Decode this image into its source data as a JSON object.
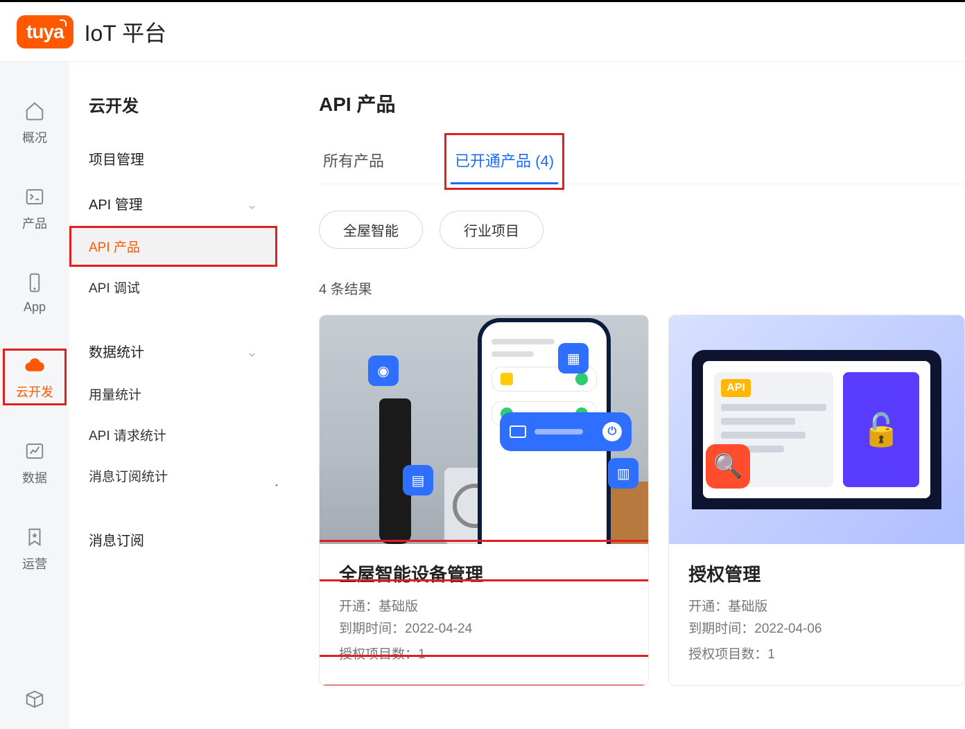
{
  "header": {
    "logo_text": "tuya",
    "platform": "IoT 平台"
  },
  "icon_rail": [
    {
      "id": "overview",
      "label": "概况"
    },
    {
      "id": "product",
      "label": "产品"
    },
    {
      "id": "app",
      "label": "App"
    },
    {
      "id": "cloud-dev",
      "label": "云开发",
      "active": true
    },
    {
      "id": "data",
      "label": "数据"
    },
    {
      "id": "operations",
      "label": "运营"
    }
  ],
  "sidebar": {
    "title": "云开发",
    "items": [
      {
        "type": "single",
        "label": "项目管理"
      },
      {
        "type": "group",
        "label": "API 管理",
        "expanded": true,
        "children": [
          {
            "label": "API 产品",
            "active": true,
            "highlight": true
          },
          {
            "label": "API 调试"
          }
        ]
      },
      {
        "type": "group",
        "label": "数据统计",
        "expanded": true,
        "children": [
          {
            "label": "用量统计"
          },
          {
            "label": "API 请求统计"
          },
          {
            "label": "消息订阅统计"
          }
        ]
      },
      {
        "type": "single",
        "label": "消息订阅"
      }
    ]
  },
  "main": {
    "page_title": "API 产品",
    "tabs": [
      {
        "label": "所有产品"
      },
      {
        "label": "已开通产品 (4)",
        "active": true,
        "highlight": true
      }
    ],
    "filters": [
      {
        "label": "全屋智能"
      },
      {
        "label": "行业项目"
      }
    ],
    "results_label": "4 条结果",
    "cards": [
      {
        "title": "全屋智能设备管理",
        "plan_label": "开通：基础版",
        "expire_label": "到期时间：2022-04-24",
        "auth_label": "授权项目数：1"
      },
      {
        "title": "授权管理",
        "plan_label": "开通：基础版",
        "expire_label": "到期时间：2022-04-06",
        "auth_label": "授权项目数：1"
      }
    ]
  }
}
